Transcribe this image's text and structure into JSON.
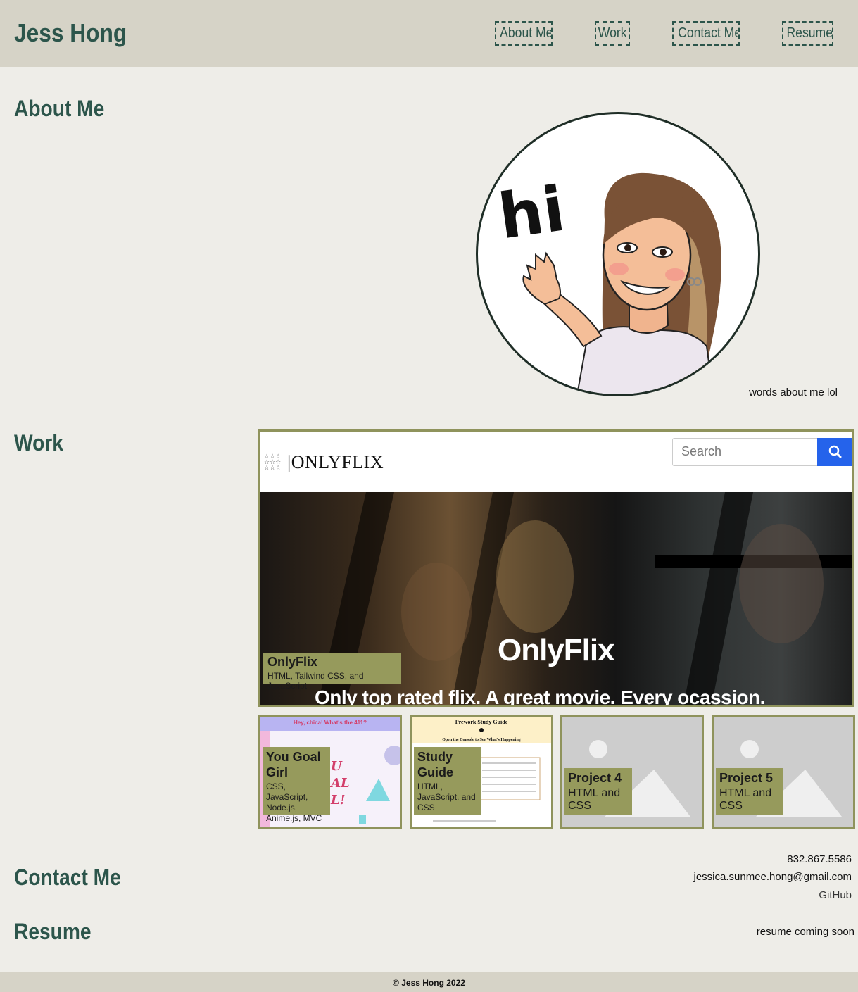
{
  "header": {
    "brand": "Jess Hong",
    "nav": [
      "About Me",
      "Work",
      "Contact Me",
      "Resume"
    ]
  },
  "about": {
    "heading": "About Me",
    "avatar_text": "hi",
    "text": "words about me lol"
  },
  "work": {
    "heading": "Work",
    "featured": {
      "title": "OnlyFlix",
      "stack": "HTML, Tailwind CSS, and JavaScript",
      "preview": {
        "logo": "ONLYFLIX",
        "search_placeholder": "Search",
        "hero_title": "OnlyFlix",
        "hero_subtitle": "Only top rated flix. A great movie. Every ocassion."
      }
    },
    "projects": [
      {
        "title": "You Goal Girl",
        "stack": "CSS, JavaScript, Node.js, Anime.js, MVC",
        "preview_header": "Hey, chica! What's the 411?"
      },
      {
        "title": "Study Guide",
        "stack": "HTML, JavaScript, and CSS",
        "preview_header": "Prework Study Guide",
        "preview_sub": "Open the Console to See What's Happening"
      },
      {
        "title": "Project 4",
        "stack": "HTML and CSS"
      },
      {
        "title": "Project 5",
        "stack": "HTML and CSS"
      }
    ]
  },
  "contact": {
    "heading": "Contact Me",
    "phone": "832.867.5586",
    "email": "jessica.sunmee.hong@gmail.com",
    "github": "GitHub"
  },
  "resume": {
    "heading": "Resume",
    "text": "resume coming soon"
  },
  "footer": {
    "text": "© Jess Hong 2022"
  },
  "colors": {
    "header_bg": "#d6d3c7",
    "page_bg": "#eeede8",
    "heading": "#2c554b",
    "tag_bg": "#969a5c",
    "card_border": "#8f935c",
    "search_button": "#2563eb"
  }
}
